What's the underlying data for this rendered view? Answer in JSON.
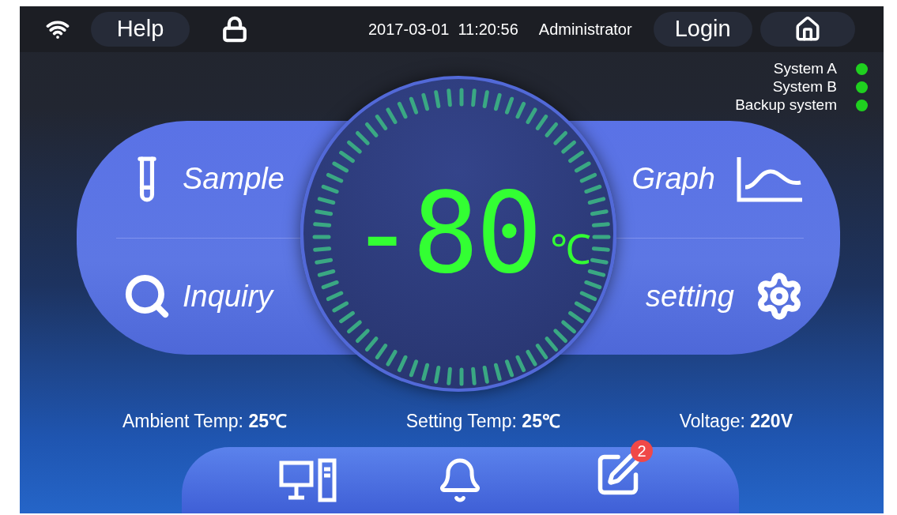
{
  "top_bar": {
    "help_button": "Help",
    "datetime": "2017-03-01  11:20:56",
    "user": "Administrator",
    "login_button": "Login"
  },
  "systems": [
    {
      "name": "System A",
      "color": "#1fd01f"
    },
    {
      "name": "System B",
      "color": "#1fd01f"
    },
    {
      "name": "Backup system",
      "color": "#1fd01f"
    }
  ],
  "menu_left": [
    {
      "label": "Sample"
    },
    {
      "label": "Inquiry"
    }
  ],
  "menu_right": [
    {
      "label": "Graph"
    },
    {
      "label": "setting"
    }
  ],
  "temperature": {
    "value": "-80",
    "unit": "℃"
  },
  "readings": [
    {
      "label": "Ambient Temp:",
      "value": "25℃"
    },
    {
      "label": "Setting Temp:",
      "value": "25℃"
    },
    {
      "label": "Voltage:",
      "value": "220V"
    }
  ],
  "bottom_nav": {
    "notes_badge": "2"
  }
}
